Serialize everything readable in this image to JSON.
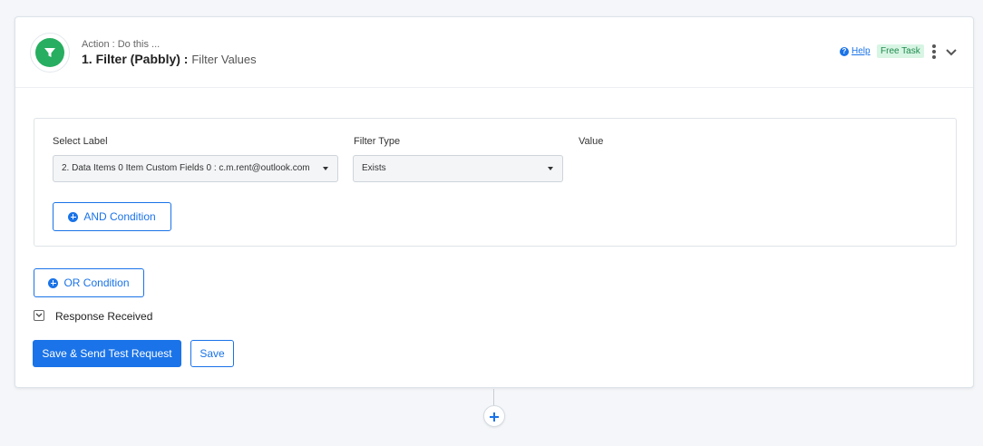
{
  "header": {
    "action_sub": "Action : Do this ...",
    "step_title": "1. Filter (Pabbly) :",
    "event_name": "Filter Values",
    "help_label": "Help",
    "free_task_badge": "Free Task"
  },
  "filter": {
    "select_label": "Select Label",
    "filter_type_label": "Filter Type",
    "value_label": "Value",
    "selected_label_value": "2. Data Items 0 Item Custom Fields 0 : c.m.rent@outlook.com",
    "filter_type_value": "Exists",
    "and_condition_label": "AND Condition"
  },
  "or_condition_label": "OR Condition",
  "response_received_label": "Response Received",
  "buttons": {
    "save_send_label": "Save & Send Test Request",
    "save_label": "Save"
  },
  "colors": {
    "primary": "#1a73e8",
    "app_icon": "#27ae60",
    "badge_bg": "#d8f5e4",
    "badge_text": "#1f8a4c"
  },
  "icons": {
    "app": "filter-icon",
    "help": "question-circle-icon",
    "menu": "kebab-menu-icon",
    "collapse": "chevron-down-icon",
    "add_condition": "plus-circle-icon",
    "add_step": "plus-icon"
  }
}
